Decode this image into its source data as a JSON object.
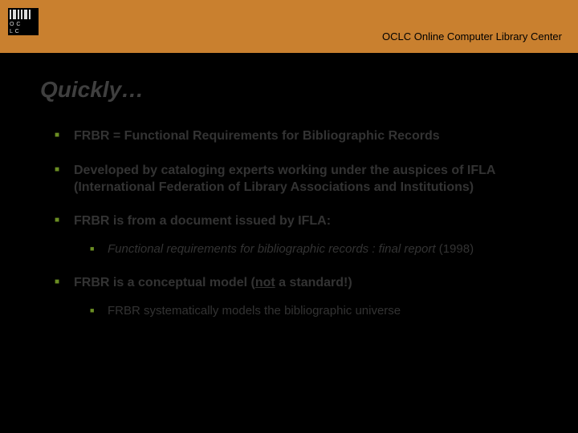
{
  "header": {
    "logo_text_line1": "O C",
    "logo_text_line2": "L C",
    "org_name": "OCLC Online Computer Library Center"
  },
  "slide": {
    "title": "Quickly…",
    "bullets": [
      {
        "text": "FRBR = Functional Requirements for Bibliographic Records",
        "sub": []
      },
      {
        "text": "Developed by cataloging experts working under the auspices of IFLA (International Federation of Library Associations and Institutions)",
        "sub": []
      },
      {
        "text": "FRBR is from a document issued by IFLA:",
        "sub": [
          {
            "italic_part": "Functional requirements for bibliographic records : final report",
            "rest": " (1998)"
          }
        ]
      },
      {
        "pre": "FRBR is a conceptual model (",
        "underline": "not",
        "post": " a standard!)",
        "sub": [
          {
            "text": "FRBR systematically models the bibliographic universe"
          }
        ]
      }
    ]
  }
}
